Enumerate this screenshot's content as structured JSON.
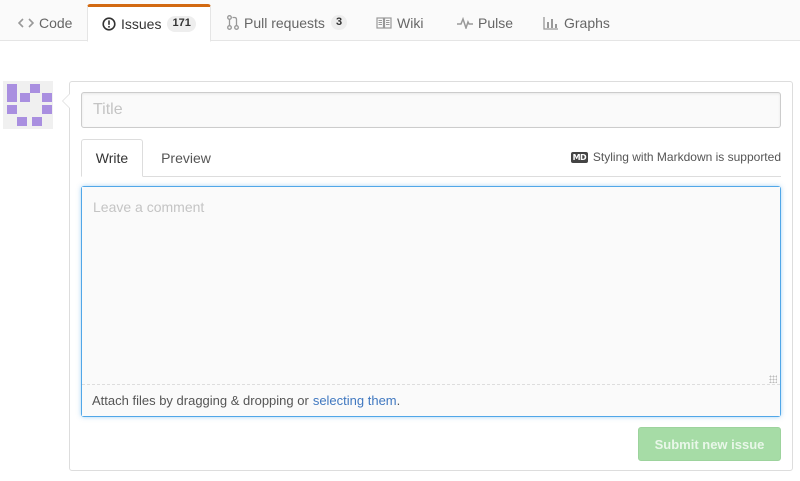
{
  "reponav": {
    "items": [
      {
        "label": "Code",
        "icon": "code-icon"
      },
      {
        "label": "Issues",
        "icon": "issue-opened-icon",
        "count": "171",
        "selected": true
      },
      {
        "label": "Pull requests",
        "icon": "git-pull-request-icon",
        "count": "3"
      },
      {
        "label": "Wiki",
        "icon": "book-icon"
      },
      {
        "label": "Pulse",
        "icon": "pulse-icon"
      },
      {
        "label": "Graphs",
        "icon": "graph-icon"
      }
    ]
  },
  "form": {
    "title_placeholder": "Title",
    "tabs": {
      "write": "Write",
      "preview": "Preview"
    },
    "markdown_badge": "MD",
    "markdown_hint": "Styling with Markdown is supported",
    "comment_placeholder": "Leave a comment",
    "attach_text": "Attach files by dragging & dropping or",
    "attach_link": "selecting them",
    "attach_suffix": ".",
    "submit_label": "Submit new issue"
  },
  "colors": {
    "accent_tab_border": "#d26911",
    "link": "#4078c0",
    "focus_border": "#51a7e8",
    "submit_disabled_bg": "#a6dca6",
    "avatar": "#a98fe0"
  }
}
